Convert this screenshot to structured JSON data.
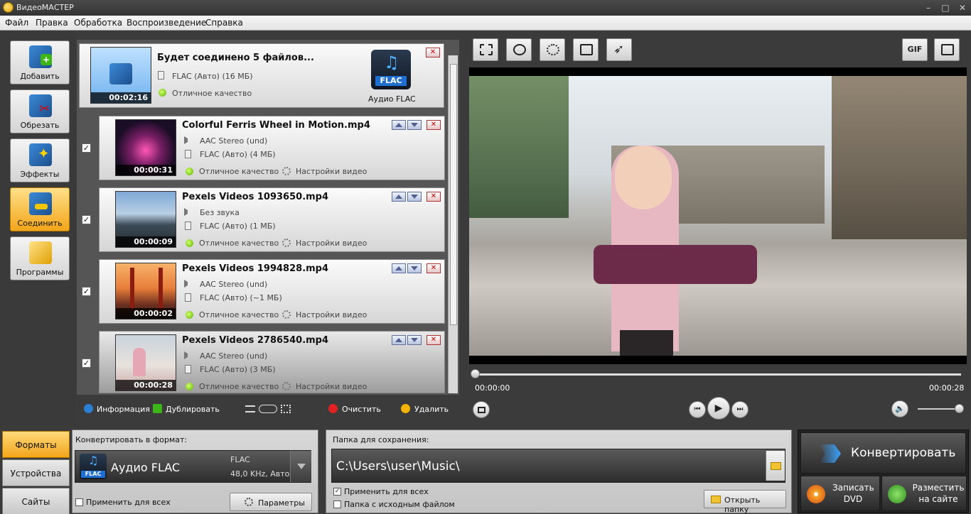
{
  "window": {
    "title": "ВидеоМАСТЕР"
  },
  "menu": [
    "Файл",
    "Правка",
    "Обработка",
    "Воспроизведение",
    "Справка"
  ],
  "sidebar": [
    {
      "label": "Добавить",
      "icon": "add-video-icon"
    },
    {
      "label": "Обрезать",
      "icon": "scissors-icon"
    },
    {
      "label": "Эффекты",
      "icon": "magic-wand-icon"
    },
    {
      "label": "Соединить",
      "icon": "join-icon",
      "active": true
    },
    {
      "label": "Программы",
      "icon": "tickets-icon"
    }
  ],
  "merge": {
    "title": "Будет соединено 5 файлов...",
    "format": "FLAC (Авто) (16 МБ)",
    "quality": "Отличное качество",
    "duration": "00:02:16",
    "format_badge": "FLAC",
    "format_label": "Аудио FLAC"
  },
  "files": [
    {
      "name": "Colorful Ferris Wheel in Motion.mp4",
      "audio": "AAC Stereo (und)",
      "format": "FLAC (Авто) (4 МБ)",
      "quality": "Отличное качество",
      "settings": "Настройки видео",
      "duration": "00:00:31",
      "checked": "✓"
    },
    {
      "name": "Pexels Videos 1093650.mp4",
      "audio": "Без звука",
      "format": "FLAC (Авто) (1 МБ)",
      "quality": "Отличное качество",
      "settings": "Настройки видео",
      "duration": "00:00:09",
      "checked": "✓"
    },
    {
      "name": "Pexels Videos 1994828.mp4",
      "audio": "AAC Stereo (und)",
      "format": "FLAC (Авто) (~1 МБ)",
      "quality": "Отличное качество",
      "settings": "Настройки видео",
      "duration": "00:00:02",
      "checked": "✓"
    },
    {
      "name": "Pexels Videos 2786540.mp4",
      "audio": "AAC Stereo (und)",
      "format": "FLAC (Авто) (3 МБ)",
      "quality": "Отличное качество",
      "settings": "Настройки видео",
      "duration": "00:00:28",
      "checked": "✓"
    }
  ],
  "list_tools": {
    "info": "Информация",
    "duplicate": "Дублировать",
    "clear": "Очистить",
    "delete": "Удалить"
  },
  "preview_tools": [
    "crop-icon",
    "stabilize-icon",
    "brightness-icon",
    "rotate-icon",
    "speed-icon"
  ],
  "preview_right_tools": {
    "gif": "GIF",
    "fullscreen": "fullscreen-icon"
  },
  "player": {
    "time_current": "00:00:00",
    "time_total": "00:00:28"
  },
  "tabs": [
    "Форматы",
    "Устройства",
    "Сайты"
  ],
  "convert_format": {
    "heading": "Конвертировать в формат:",
    "name": "Аудио FLAC",
    "badge": "FLAC",
    "codec": "FLAC",
    "params": "48,0 KHz, Авто",
    "apply_all": "Применить для всех",
    "params_button": "Параметры"
  },
  "save_folder": {
    "heading": "Папка для сохранения:",
    "path": "C:\\Users\\user\\Music\\",
    "apply_all": "Применить для всех",
    "source_folder": "Папка с исходным файлом",
    "open_button": "Открыть папку"
  },
  "actions": {
    "convert": "Конвертировать",
    "dvd_line1": "Записать",
    "dvd_line2": "DVD",
    "site_line1": "Разместить",
    "site_line2": "на сайте"
  },
  "colors": {
    "accent": "#f3a619",
    "panel_dark": "#3b3b3b"
  }
}
